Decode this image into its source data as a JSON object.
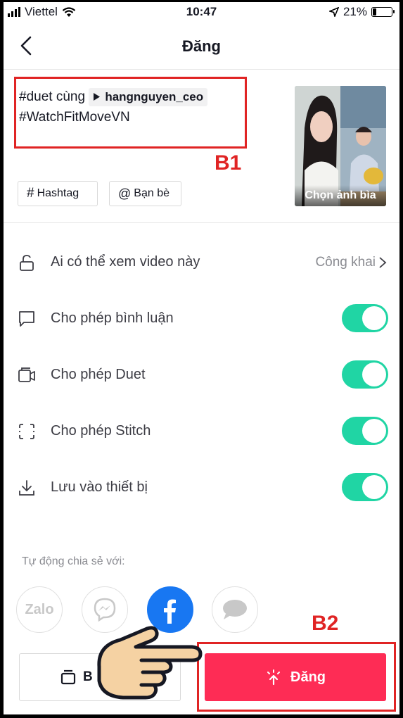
{
  "status_bar": {
    "carrier": "Viettel",
    "time": "10:47",
    "battery": "21%",
    "battery_level": 0.21
  },
  "header": {
    "title": "Đăng",
    "back_icon": "chevron-left-icon"
  },
  "caption": {
    "line1_prefix": "#duet cùng",
    "mention": "hangnguyen_ceo",
    "line2": "#WatchFitMoveVN"
  },
  "annotations": {
    "b1": "B1",
    "b2": "B2",
    "color": "#e02424"
  },
  "tag_buttons": {
    "hashtag": "Hashtag",
    "hashtag_symbol": "#",
    "friends": "Bạn bè",
    "friends_symbol": "@"
  },
  "cover": {
    "label": "Chọn ảnh bìa"
  },
  "settings": {
    "privacy": {
      "label": "Ai có thể xem video này",
      "value": "Công khai"
    },
    "comments": {
      "label": "Cho phép bình luận",
      "on": true
    },
    "duet": {
      "label": "Cho phép Duet",
      "on": true
    },
    "stitch": {
      "label": "Cho phép Stitch",
      "on": true
    },
    "save": {
      "label": "Lưu vào thiết bị",
      "on": true
    }
  },
  "share": {
    "title": "Tự động chia sẻ với:",
    "zalo": "Zalo"
  },
  "bottom": {
    "draft_label": "B",
    "post_label": "Đăng"
  },
  "colors": {
    "accent": "#fe2c55",
    "toggle_on": "#20d5a4",
    "facebook": "#1877f2"
  }
}
